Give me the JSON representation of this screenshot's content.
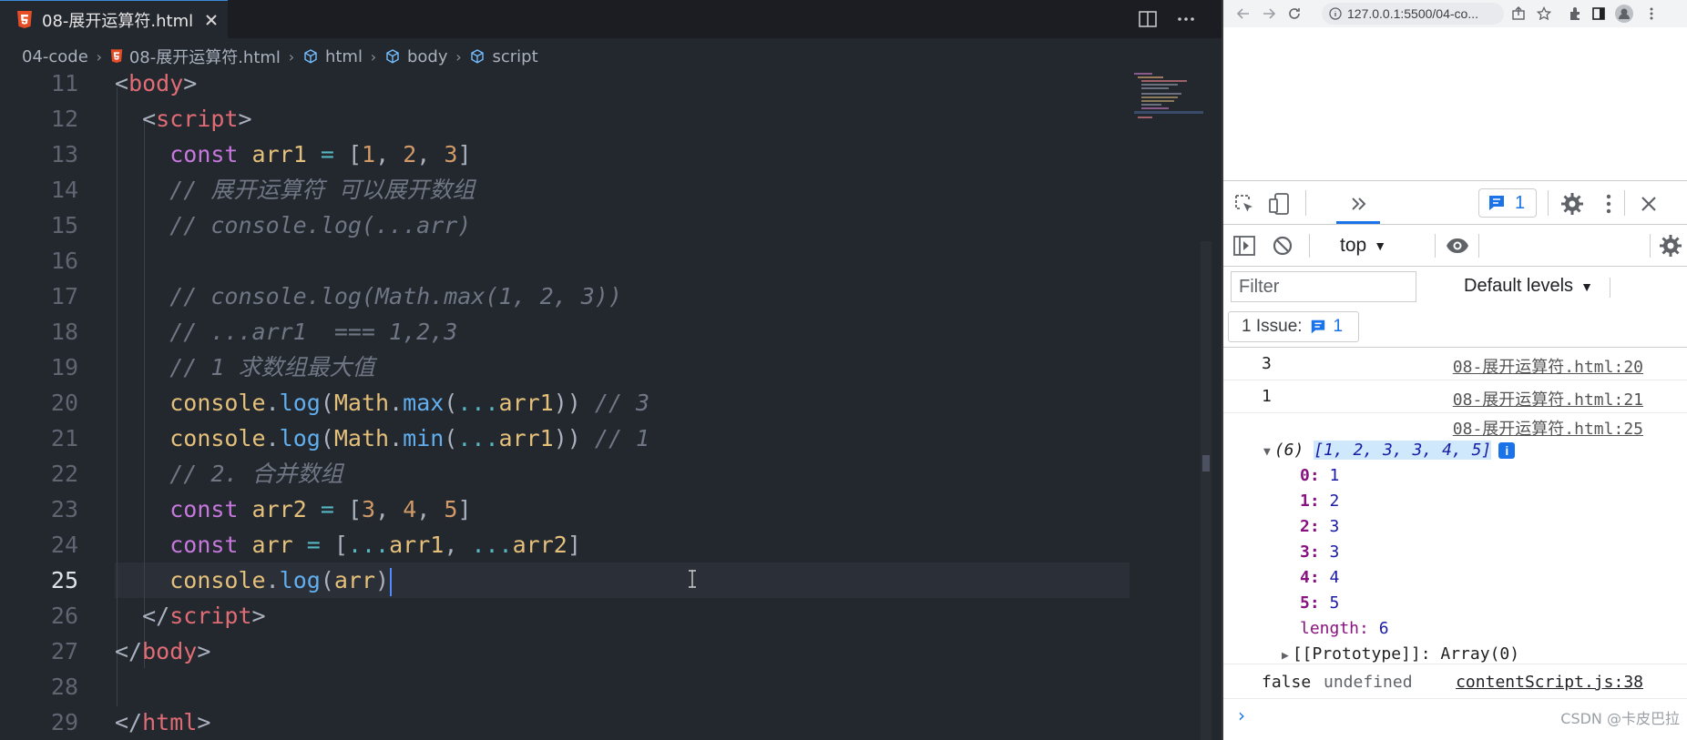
{
  "editor": {
    "tab_title": "08-展开运算符.html",
    "breadcrumb": [
      "04-code",
      "08-展开运算符.html",
      "html",
      "body",
      "script"
    ]
  },
  "browser": {
    "url": "127.0.0.1:5500/04-co..."
  },
  "devtools": {
    "issues_count": "1",
    "context": "top",
    "filter_placeholder": "Filter",
    "levels_label": "Default levels",
    "issues_label": "1 Issue:",
    "issues_label_count": "1",
    "logs": [
      {
        "value": "3",
        "source": "08-展开运算符.html:20"
      },
      {
        "value": "1",
        "source": "08-展开运算符.html:21"
      },
      {
        "value": "",
        "source": "08-展开运算符.html:25"
      }
    ],
    "array_summary_len": "(6)",
    "array_summary": "[1, 2, 3, 3, 4, 5]",
    "array_entries": [
      {
        "k": "0",
        "v": "1"
      },
      {
        "k": "1",
        "v": "2"
      },
      {
        "k": "2",
        "v": "3"
      },
      {
        "k": "3",
        "v": "3"
      },
      {
        "k": "4",
        "v": "4"
      },
      {
        "k": "5",
        "v": "5"
      }
    ],
    "length_key": "length",
    "length_val": "6",
    "prototype": "[[Prototype]]: Array(0)",
    "last_log_a": "false",
    "last_log_b": "undefined",
    "last_log_source": "contentScript.js:38",
    "watermark": "CSDN @卡皮巴拉"
  }
}
